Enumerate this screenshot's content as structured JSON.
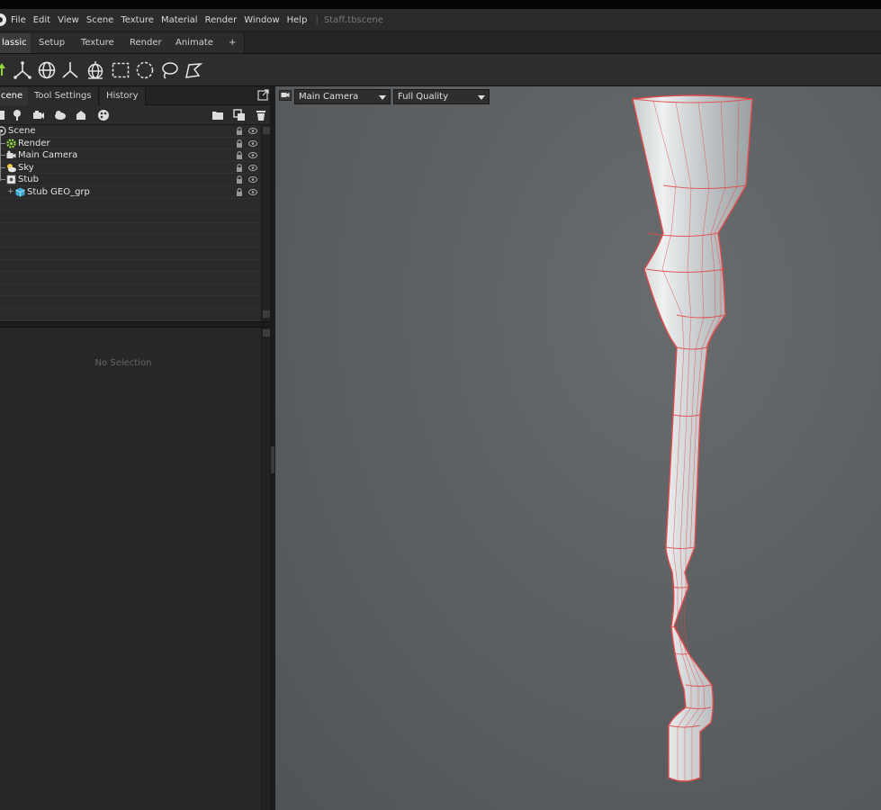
{
  "menubar": {
    "items": [
      "File",
      "Edit",
      "View",
      "Scene",
      "Texture",
      "Material",
      "Render",
      "Window",
      "Help"
    ],
    "separator": "|",
    "file_title": "Staff.tbscene"
  },
  "workspace_tabs": [
    "lassic",
    "Setup",
    "Texture",
    "Render",
    "Animate",
    "+"
  ],
  "panel": {
    "tabs": [
      "cene",
      "Tool Settings",
      "History"
    ]
  },
  "outliner": {
    "items": [
      {
        "label": "Scene",
        "icon": "scene-icon"
      },
      {
        "label": "Render",
        "icon": "gear-icon"
      },
      {
        "label": "Main Camera",
        "icon": "camera-icon"
      },
      {
        "label": "Sky",
        "icon": "sky-icon"
      },
      {
        "label": "Stub",
        "icon": "object-icon"
      },
      {
        "label": "Stub GEO_grp",
        "icon": "cube-icon"
      }
    ],
    "expand_symbol": "+"
  },
  "properties": {
    "empty_text": "No Selection"
  },
  "viewport": {
    "camera_select": "Main Camera",
    "quality_select": "Full Quality",
    "wireframe_color": "#e04a4a"
  },
  "colors": {
    "accent_green": "#8fd43a",
    "menubar_bg": "#2b2b2b",
    "viewport_bg": "#5e6264"
  }
}
